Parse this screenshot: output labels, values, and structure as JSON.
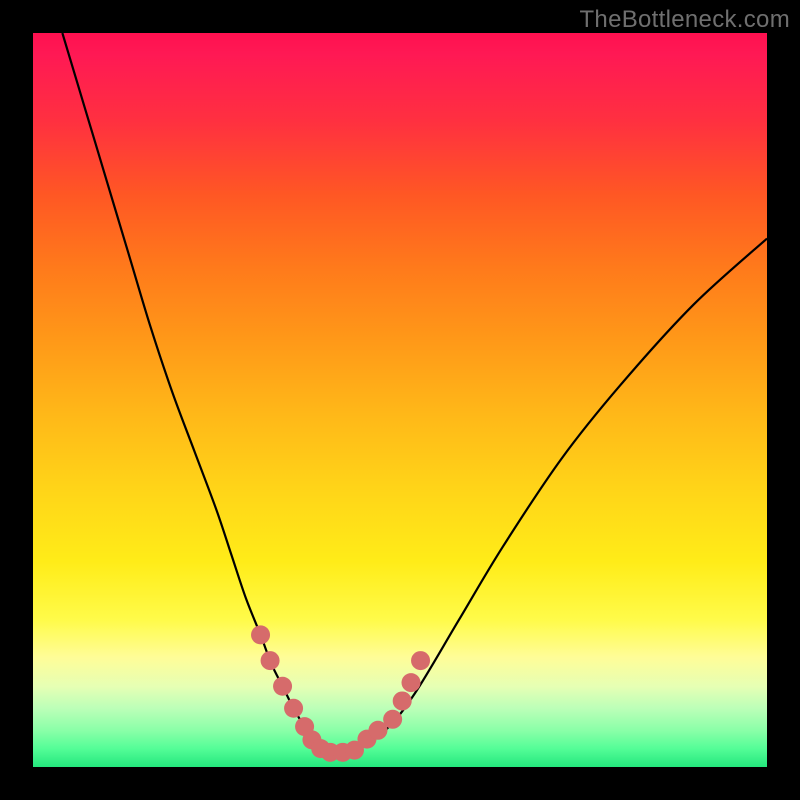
{
  "watermark": "TheBottleneck.com",
  "colors": {
    "frame": "#000000",
    "curve_stroke": "#000000",
    "marker_fill": "#d66b6b",
    "marker_stroke": "#b74f4f"
  },
  "chart_data": {
    "type": "line",
    "title": "",
    "xlabel": "",
    "ylabel": "",
    "xlim": [
      0,
      100
    ],
    "ylim": [
      0,
      100
    ],
    "grid": false,
    "series": [
      {
        "name": "bottleneck-curve",
        "x": [
          4,
          7,
          10,
          13,
          16,
          19,
          22,
          25,
          27,
          29,
          31,
          32.5,
          34,
          35.5,
          37,
          38.5,
          40,
          42,
          44,
          48,
          52,
          58,
          64,
          72,
          80,
          90,
          100
        ],
        "y": [
          100,
          90,
          80,
          70,
          60,
          51,
          43,
          35,
          29,
          23,
          18,
          14,
          11,
          8,
          5.5,
          3.8,
          2.5,
          2,
          2.5,
          5,
          10,
          20,
          30,
          42,
          52,
          63,
          72
        ]
      }
    ],
    "markers": [
      {
        "x": 31,
        "y": 18
      },
      {
        "x": 32.3,
        "y": 14.5
      },
      {
        "x": 34,
        "y": 11
      },
      {
        "x": 35.5,
        "y": 8
      },
      {
        "x": 37,
        "y": 5.5
      },
      {
        "x": 38,
        "y": 3.7
      },
      {
        "x": 39.2,
        "y": 2.5
      },
      {
        "x": 40.5,
        "y": 2
      },
      {
        "x": 42.2,
        "y": 2
      },
      {
        "x": 43.8,
        "y": 2.3
      },
      {
        "x": 45.5,
        "y": 3.8
      },
      {
        "x": 47,
        "y": 5
      },
      {
        "x": 49,
        "y": 6.5
      },
      {
        "x": 50.3,
        "y": 9
      },
      {
        "x": 51.5,
        "y": 11.5
      },
      {
        "x": 52.8,
        "y": 14.5
      }
    ],
    "background_gradient": {
      "top": "#ff1050",
      "bottom": "#24e77d"
    }
  }
}
